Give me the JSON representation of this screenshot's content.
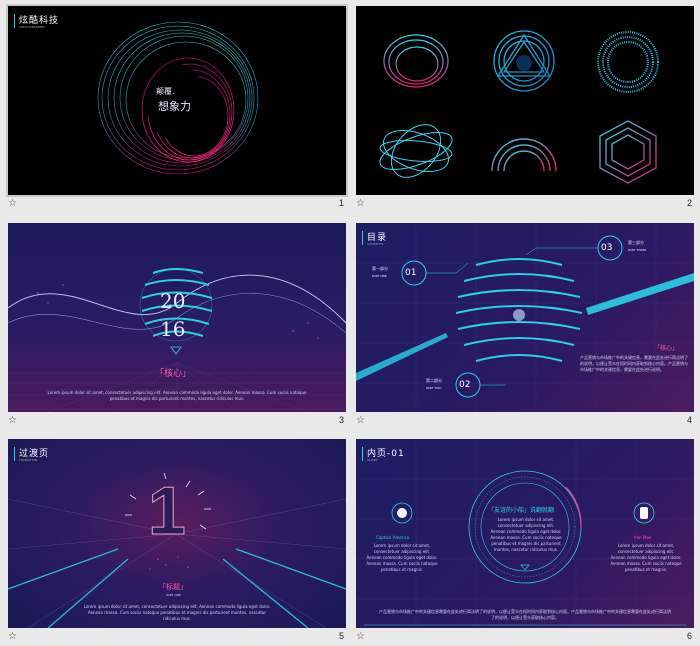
{
  "slides": [
    {
      "number": "1",
      "title": "炫酷科技",
      "subtitle": "CREATIVEEXPERT",
      "line1": "颠覆.",
      "line2": "想象力"
    },
    {
      "number": "2"
    },
    {
      "number": "3",
      "year_top": "20",
      "year_bottom": "16",
      "heading": "「核心」",
      "body": "Lorem ipsum dolor sit amet, consectetuer adipiscing elit. Aenean commodo ligula eget dolor. Aenean massa. Cum sociis natoque penatibus et magnis dis parturient montes, nascetur ridiculus mus."
    },
    {
      "number": "4",
      "title": "目录",
      "subtitle": "CONTENTS",
      "items": [
        {
          "num": "01",
          "cn": "第一部分",
          "en": "PART ONE"
        },
        {
          "num": "02",
          "cn": "第二部分",
          "en": "PART TWO"
        },
        {
          "num": "03",
          "cn": "第三部分",
          "en": "PART THREE"
        }
      ],
      "heading": "「核心」",
      "body": "产品营销与市场推广中的关键信息，需要在此处进行简洁明了的说明，以便让受众在短时间内获取到核心内容。产品营销与市场推广中的关键信息，需要在此处进行说明。"
    },
    {
      "number": "5",
      "title": "过渡页",
      "subtitle": "TRANSITION",
      "big": "1",
      "heading": "「标题」",
      "heading_sub": "PART ONE",
      "body": "Lorem ipsum dolor sit amet, consectetuer adipiscing elit. Aenean commodo ligula eget dolor. Aenean massa. Cum sociis natoque penatibus et magnis dis parturient montes, nascetur ridiculus mus."
    },
    {
      "number": "6",
      "title": "内页-01",
      "subtitle": "SLIDES",
      "circle_heading": "「友谊的小船」说翻就翻",
      "circle_body": "Lorem ipsum dolor sit amet, consectetuer adipiscing elit. Aenean commodo ligula eget dolor. Aenean massa. Cum sociis natoque penatibus et magnis dis parturient montes, nascetur ridiculus mus.",
      "left_name": "Captain America",
      "left_body": "Lorem ipsum dolor sit amet, consectetuer adipiscing elit. Aenean commodo ligula eget dolor. Aenean massa. Cum sociis natoque penatibus et magnis.",
      "right_name": "Iron Man",
      "right_body": "Lorem ipsum dolor sit amet, consectetuer adipiscing elit. Aenean commodo ligula eget dolor. Aenean massa. Cum sociis natoque penatibus et magnis.",
      "bottom": "产品营销与市场推广中的关键信息需要在此处进行简洁明了的说明，以便让受众在短时间内获取到核心内容。产品营销与市场推广中的关键信息需要在此处进行简洁明了的说明，以便让受众获取核心内容。"
    }
  ]
}
